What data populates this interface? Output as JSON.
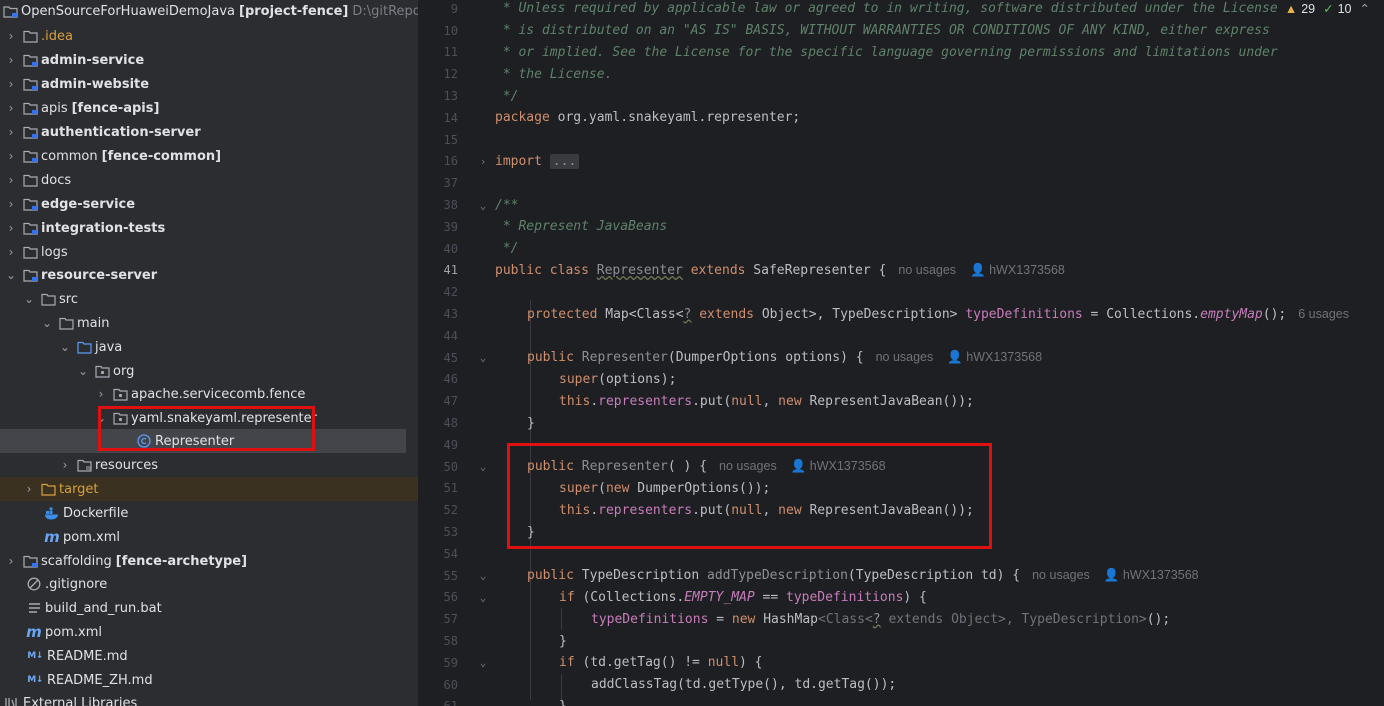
{
  "project": {
    "name": "OpenSourceForHuaweiDemoJava",
    "module": "[project-fence]",
    "path": "D:\\gitRepository\\"
  },
  "tree": [
    {
      "label": "OpenSourceForHuaweiDemoJava",
      "extra": "[project-fence]",
      "path": "D:\\gitRepository\\"
    },
    {
      "label": ".idea"
    },
    {
      "label": "admin-service"
    },
    {
      "label": "admin-website"
    },
    {
      "label": "apis",
      "extra": "[fence-apis]"
    },
    {
      "label": "authentication-server"
    },
    {
      "label": "common",
      "extra": "[fence-common]"
    },
    {
      "label": "docs"
    },
    {
      "label": "edge-service"
    },
    {
      "label": "integration-tests"
    },
    {
      "label": "logs"
    },
    {
      "label": "resource-server"
    },
    {
      "label": "src"
    },
    {
      "label": "main"
    },
    {
      "label": "java"
    },
    {
      "label": "org"
    },
    {
      "label": "apache.servicecomb.fence"
    },
    {
      "label": "yaml.snakeyaml.representer"
    },
    {
      "label": "Representer"
    },
    {
      "label": "resources"
    },
    {
      "label": "target"
    },
    {
      "label": "Dockerfile"
    },
    {
      "label": "pom.xml"
    },
    {
      "label": "scaffolding",
      "extra": "[fence-archetype]"
    },
    {
      "label": ".gitignore"
    },
    {
      "label": "build_and_run.bat"
    },
    {
      "label": "pom.xml"
    },
    {
      "label": "README.md"
    },
    {
      "label": "README_ZH.md"
    },
    {
      "label": "External Libraries"
    }
  ],
  "md_badge": "M↓",
  "maven_badge": "m",
  "inspections": {
    "warnings": "29",
    "ok": "10"
  },
  "editor": {
    "lines": [
      {
        "n": "9",
        "text": " * Unless required by applicable law or agreed to in writing, software distributed under the License"
      },
      {
        "n": "10",
        "text": " * is distributed on an \"AS IS\" BASIS, WITHOUT WARRANTIES OR CONDITIONS OF ANY KIND, either express"
      },
      {
        "n": "11",
        "text": " * or implied. See the License for the specific language governing permissions and limitations under"
      },
      {
        "n": "12",
        "text": " * the License."
      },
      {
        "n": "13",
        "text": " */"
      },
      {
        "n": "14",
        "kw": "package",
        "text": " org.yaml.snakeyaml.representer;"
      },
      {
        "n": "15"
      },
      {
        "n": "16",
        "kw": "import",
        "fold_text": "..."
      },
      {
        "n": "37"
      },
      {
        "n": "38",
        "text": "/**"
      },
      {
        "n": "39",
        "text": " * Represent JavaBeans"
      },
      {
        "n": "40",
        "text": " */"
      },
      {
        "n": "41",
        "kw1": "public",
        "kw2": "class",
        "cls": "Representer",
        "kw3": "extends",
        "rest": " SafeRepresenter {",
        "hint": "no usages",
        "author": "hWX1373568"
      },
      {
        "n": "42"
      },
      {
        "n": "43",
        "kw1": "protected",
        "t1": " Map<Class<",
        "q": "?",
        "kw2": " extends",
        "t2": " Object>, TypeDescription> ",
        "fld": "typeDefinitions",
        "t3": " = Collections.",
        "st": "emptyMap",
        "t4": "();",
        "hint": "6 usages"
      },
      {
        "n": "44"
      },
      {
        "n": "45",
        "kw1": "public",
        "ctor": " Representer",
        "t1": "(DumperOptions options) {",
        "hint": "no usages",
        "author": "hWX1373568"
      },
      {
        "n": "46",
        "kw1": "super",
        "t1": "(options);"
      },
      {
        "n": "47",
        "kw1": "this",
        "t1": ".",
        "fld": "representers",
        "t2": ".put(",
        "kw2": "null",
        "t3": ", ",
        "kw3": "new",
        "t4": " RepresentJavaBean());"
      },
      {
        "n": "48",
        "t1": "}"
      },
      {
        "n": "49"
      },
      {
        "n": "50",
        "kw1": "public",
        "ctor": " Representer",
        "t1": "( ) {",
        "hint": "no usages",
        "author": "hWX1373568"
      },
      {
        "n": "51",
        "kw1": "super",
        "t1": "(",
        "kw2": "new",
        "t2": " DumperOptions());"
      },
      {
        "n": "52",
        "kw1": "this",
        "t1": ".",
        "fld": "representers",
        "t2": ".put(",
        "kw2": "null",
        "t3": ", ",
        "kw3": "new",
        "t4": " RepresentJavaBean());"
      },
      {
        "n": "53",
        "t1": "}"
      },
      {
        "n": "54"
      },
      {
        "n": "55",
        "kw1": "public",
        "t1": " TypeDescription ",
        "fn": "addTypeDescription",
        "t2": "(TypeDescription td) {",
        "hint": "no usages",
        "author": "hWX1373568"
      },
      {
        "n": "56",
        "kw1": "if",
        "t1": " (Collections.",
        "st": "EMPTY_MAP",
        "t2": " == ",
        "fld": "typeDefinitions",
        "t3": ") {"
      },
      {
        "n": "57",
        "fld": "typeDefinitions",
        "t1": " = ",
        "kw1": "new",
        "t2": " HashMap",
        "g1": "<Class<",
        "q": "?",
        "g2": " extends Object>, TypeDescription>",
        "t3": "();"
      },
      {
        "n": "58",
        "t1": "}"
      },
      {
        "n": "59",
        "kw1": "if",
        "t1": " (td.getTag() != ",
        "kw2": "null",
        "t2": ") {"
      },
      {
        "n": "60",
        "t1": "addClassTag(td.getType(), td.getTag());"
      },
      {
        "n": "61",
        "t1": "}"
      }
    ]
  }
}
